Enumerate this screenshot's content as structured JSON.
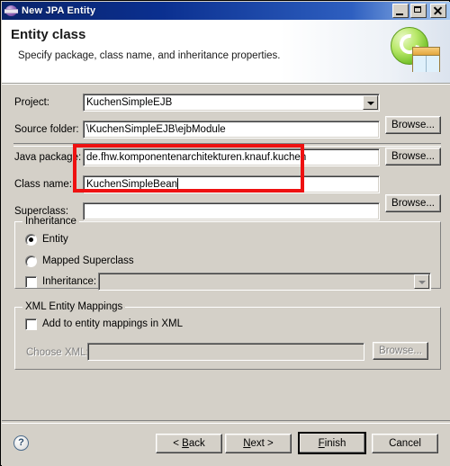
{
  "window": {
    "title": "New JPA Entity",
    "icon": "eclipse-globe-icon",
    "minimize_label": "Minimize",
    "maximize_label": "Maximize",
    "close_label": "Close"
  },
  "banner": {
    "title": "Entity class",
    "subtitle": "Specify package, class name, and inheritance properties.",
    "icon": "jpa-entity-banner-icon"
  },
  "form": {
    "project": {
      "label": "Project:",
      "value": "KuchenSimpleEJB",
      "placeholder": ""
    },
    "source_folder": {
      "label": "Source folder:",
      "value": "\\KuchenSimpleEJB\\ejbModule",
      "placeholder": "",
      "browse_label": "Browse..."
    },
    "java_package": {
      "label": "Java package:",
      "value": "de.fhw.komponentenarchitekturen.knauf.kuchen",
      "placeholder": "",
      "browse_label": "Browse..."
    },
    "class_name": {
      "label": "Class name:",
      "value": "KuchenSimpleBean",
      "placeholder": ""
    },
    "superclass": {
      "label": "Superclass:",
      "value": "",
      "placeholder": "",
      "browse_label": "Browse..."
    }
  },
  "inheritance_group": {
    "title": "Inheritance",
    "entity_label": "Entity",
    "entity_selected": true,
    "mapped_superclass_label": "Mapped Superclass",
    "mapped_superclass_selected": false,
    "inheritance_checkbox_label": "Inheritance:",
    "inheritance_checked": false,
    "inheritance_value": "",
    "inheritance_enabled": false
  },
  "xml_group": {
    "title": "XML Entity Mappings",
    "add_to_mappings_label": "Add to entity mappings in XML",
    "add_to_mappings_checked": false,
    "choose_xml_label": "Choose XML:",
    "choose_xml_value": "",
    "choose_xml_enabled": false,
    "browse_label": "Browse..."
  },
  "footer": {
    "help_glyph": "?",
    "back_label": "< Back",
    "next_label": "Next >",
    "finish_label": "Finish",
    "cancel_label": "Cancel"
  },
  "annotation": {
    "highlight_color": "#ee1111",
    "highlight_target": "java-package-and-class-name-fields"
  }
}
